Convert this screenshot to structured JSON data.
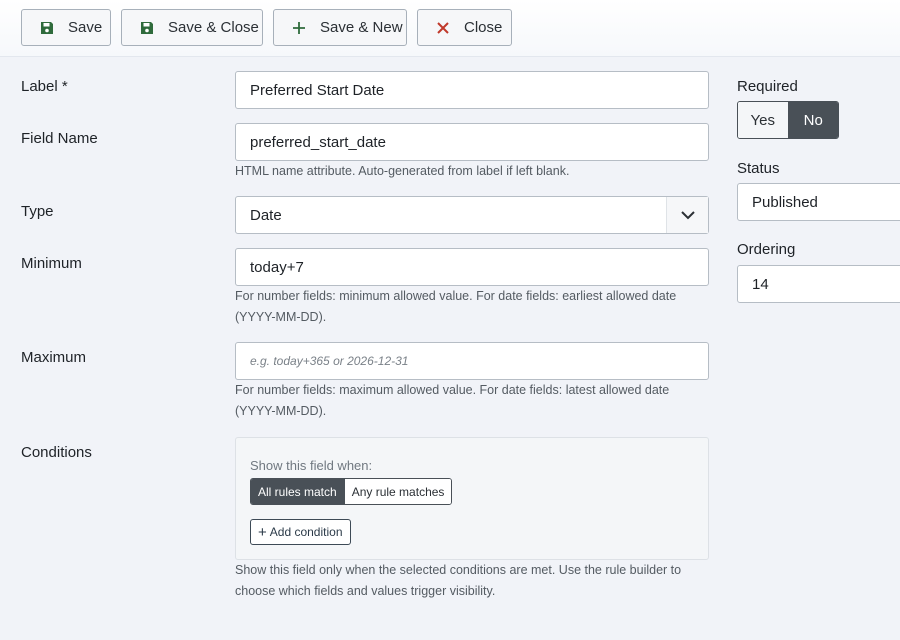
{
  "toolbar": {
    "save_label": "Save",
    "save_close_label": "Save & Close",
    "save_new_label": "Save & New",
    "close_label": "Close"
  },
  "form": {
    "label": {
      "label": "Label *",
      "value": "Preferred Start Date"
    },
    "field_name": {
      "label": "Field Name",
      "value": "preferred_start_date",
      "help": "HTML name attribute. Auto-generated from label if left blank."
    },
    "type": {
      "label": "Type",
      "value": "Date"
    },
    "minimum": {
      "label": "Minimum",
      "value": "today+7",
      "help_line1": "For number fields: minimum allowed value. For date fields: earliest allowed date",
      "help_line2": "(YYYY-MM-DD)."
    },
    "maximum": {
      "label": "Maximum",
      "placeholder": "e.g. today+365 or 2026-12-31",
      "help_line1": "For number fields: maximum allowed value. For date fields: latest allowed date",
      "help_line2": "(YYYY-MM-DD)."
    },
    "conditions": {
      "label": "Conditions",
      "title": "Show this field when:",
      "mode_all": "All rules match",
      "mode_any": "Any rule matches",
      "add_label": "Add condition",
      "help_line1": "Show this field only when the selected conditions are met. Use the rule builder to",
      "help_line2": "choose which fields and values trigger visibility."
    }
  },
  "sidebar": {
    "required": {
      "label": "Required",
      "yes": "Yes",
      "no": "No",
      "selected": "No"
    },
    "status": {
      "label": "Status",
      "value": "Published"
    },
    "ordering": {
      "label": "Ordering",
      "value": "14"
    }
  },
  "colors": {
    "save_icon": "#2f6b3c",
    "close_icon": "#c0392b",
    "toggle_active": "#495057"
  }
}
